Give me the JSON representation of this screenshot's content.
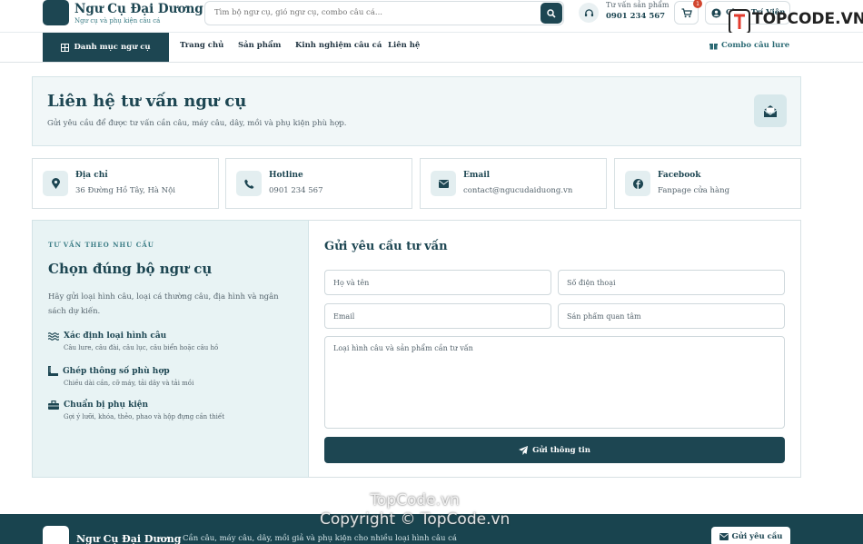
{
  "header": {
    "brand_name": "Ngư Cụ Đại Dương",
    "brand_tagline": "Ngư cụ và phụ kiện câu cá",
    "search_placeholder": "Tìm bộ ngư cụ, giỏ ngư cụ, combo câu cá...",
    "support_label": "Tư vấn sản phẩm",
    "support_phone": "0901 234 567",
    "cart_count": "1",
    "account_label": "Chọn Trí Viên"
  },
  "watermark": {
    "logo_text": "TOPCODE.VN",
    "line1": "TopCode.vn",
    "line2": "Copyright © TopCode.vn"
  },
  "nav": {
    "category_button": "Danh mục ngư cụ",
    "links": [
      "Trang chủ",
      "Sản phẩm",
      "Kinh nghiệm câu cá",
      "Liên hệ"
    ],
    "combo_link": "Combo câu lure"
  },
  "hero": {
    "title": "Liên hệ tư vấn ngư cụ",
    "subtitle": "Gửi yêu cầu để được tư vấn cần câu, máy câu, dây, mồi và phụ kiện phù hợp."
  },
  "contacts": [
    {
      "title": "Địa chỉ",
      "value": "36 Đường Hồ Tây, Hà Nội",
      "icon": "map-pin-icon"
    },
    {
      "title": "Hotline",
      "value": "0901 234 567",
      "icon": "phone-icon"
    },
    {
      "title": "Email",
      "value": "contact@ngucudaiduong.vn",
      "icon": "envelope-icon"
    },
    {
      "title": "Facebook",
      "value": "Fanpage cửa hàng",
      "icon": "facebook-icon"
    }
  ],
  "advice": {
    "eyebrow": "TƯ VẤN THEO NHU CẦU",
    "title": "Chọn đúng bộ ngư cụ",
    "description": "Hãy gửi loại hình câu, loại cá thường câu, địa hình và ngân sách dự kiến.",
    "steps": [
      {
        "title": "Xác định loại hình câu",
        "desc": "Câu lure, câu đài, câu lục, câu biển hoặc câu hồ"
      },
      {
        "title": "Ghép thông số phù hợp",
        "desc": "Chiều dài cần, cỡ máy, tải dây và tải mồi"
      },
      {
        "title": "Chuẩn bị phụ kiện",
        "desc": "Gợi ý lưỡi, khóa, thẻo, phao và hộp đựng cần thiết"
      }
    ]
  },
  "form": {
    "title": "Gửi yêu cầu tư vấn",
    "name_placeholder": "Họ và tên",
    "phone_placeholder": "Số điện thoại",
    "email_placeholder": "Email",
    "product_placeholder": "Sản phẩm quan tâm",
    "message_placeholder": "Loại hình câu và sản phẩm cần tư vấn",
    "submit_label": "Gửi thông tin"
  },
  "footer": {
    "brand_name": "Ngư Cụ Đại Dương",
    "tagline": "Cần câu, máy câu, dây, mồi giả và phụ kiện cho nhiều loại hình câu cá",
    "button_label": "Gửi yêu cầu"
  },
  "colors": {
    "primary": "#1d4652",
    "accent": "#3c7d86",
    "badge": "#d2462f"
  }
}
